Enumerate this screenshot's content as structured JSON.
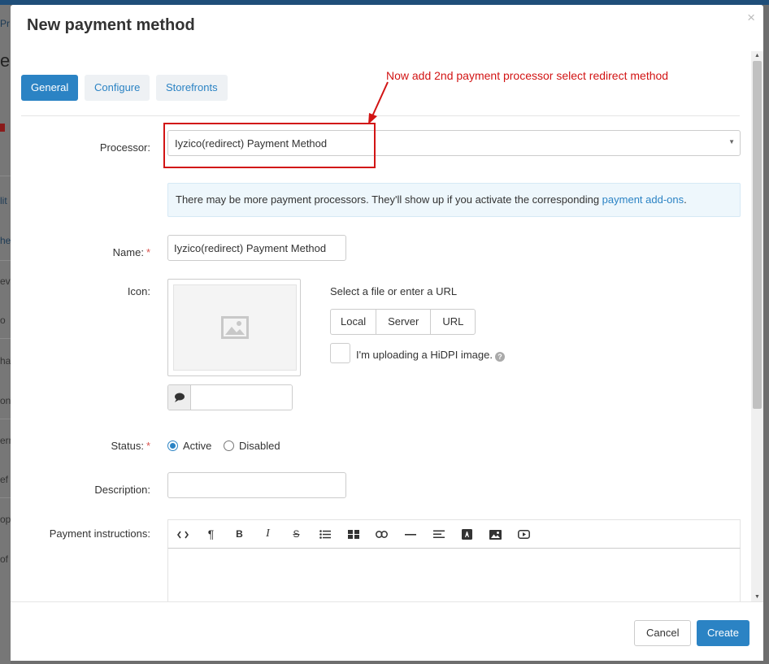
{
  "background": {
    "fragments": [
      "Pr",
      "e",
      "lit",
      "he",
      "ev",
      "o",
      "ha",
      "on",
      "ern",
      "ef",
      "op",
      "of"
    ]
  },
  "modal": {
    "title": "New payment method",
    "close": "×"
  },
  "tabs": [
    {
      "label": "General",
      "active": true
    },
    {
      "label": "Configure",
      "active": false
    },
    {
      "label": "Storefronts",
      "active": false
    }
  ],
  "annotation": "Now add 2nd payment processor select redirect  method",
  "form": {
    "processor_label": "Processor:",
    "processor_value": "Iyzico(redirect) Payment Method",
    "info_text": "There may be more payment processors. They'll show up if you activate the corresponding ",
    "info_link": "payment add-ons",
    "info_end": ".",
    "name_label": "Name:",
    "name_value": "Iyzico(redirect) Payment Method",
    "required_mark": "*",
    "icon_label": "Icon:",
    "file_hint": "Select a file or enter a URL",
    "file_buttons": [
      "Local",
      "Server",
      "URL"
    ],
    "hidpi_label": "I'm uploading a HiDPI image.",
    "help_icon": "?",
    "status_label": "Status:",
    "status_options": [
      {
        "label": "Active",
        "checked": true
      },
      {
        "label": "Disabled",
        "checked": false
      }
    ],
    "description_label": "Description:",
    "description_value": "",
    "instructions_label": "Payment instructions:",
    "toolbar_buttons": [
      "html-code",
      "paragraph-format",
      "bold",
      "italic",
      "strikethrough",
      "unordered-list",
      "table",
      "link",
      "horizontal-rule",
      "align",
      "font-color",
      "image",
      "video"
    ]
  },
  "footer": {
    "cancel": "Cancel",
    "create": "Create"
  },
  "colors": {
    "primary": "#2b83c4",
    "annotation": "#d21414",
    "required": "#d9534f"
  }
}
